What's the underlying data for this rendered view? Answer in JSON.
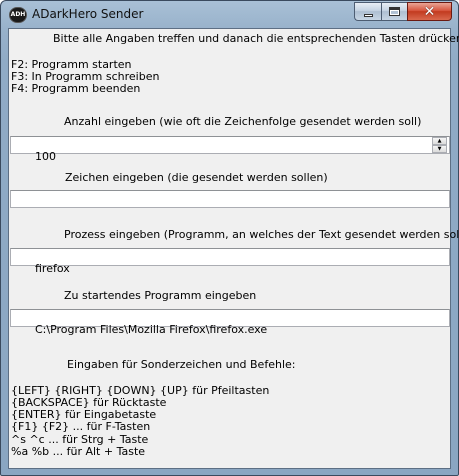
{
  "window": {
    "title": "ADarkHero Sender",
    "icon_text": "ADH"
  },
  "intro": {
    "instruction": "Bitte alle Angaben treffen und danach die entsprechenden Tasten drücken!",
    "hotkeys": [
      "F2: Programm starten",
      "F3: In Programm schreiben",
      "F4: Programm beenden"
    ]
  },
  "count": {
    "label": "Anzahl eingeben (wie oft die Zeichenfolge gesendet werden soll)",
    "value": "100"
  },
  "characters": {
    "label": "Zeichen eingeben (die gesendet werden sollen)",
    "value": ""
  },
  "process": {
    "label": "Prozess eingeben (Programm, an welches der Text gesendet werden soll)",
    "value": "firefox"
  },
  "program": {
    "label": "Zu startendes Programm eingeben",
    "value": "C:\\Program Files\\Mozilla Firefox\\firefox.exe"
  },
  "help": {
    "heading": "Eingaben für Sonderzeichen und Befehle:",
    "lines": [
      "{LEFT} {RIGHT} {DOWN} {UP} für Pfeiltasten",
      "{BACKSPACE} für Rücktaste",
      "{ENTER} für Eingabetaste",
      "{F1} {F2} ... für F-Tasten",
      "^s ^c ... für Strg + Taste",
      "%a %b ... für Alt + Taste"
    ]
  },
  "icons": {
    "minimize": "minimize-icon",
    "maximize": "maximize-icon",
    "close": "close-icon",
    "spin_up": "spin-up-icon",
    "spin_down": "spin-down-icon"
  },
  "colors": {
    "titlebar": "#98b2cb",
    "close_button": "#c23a1f",
    "client_background": "#f0f0f0"
  }
}
